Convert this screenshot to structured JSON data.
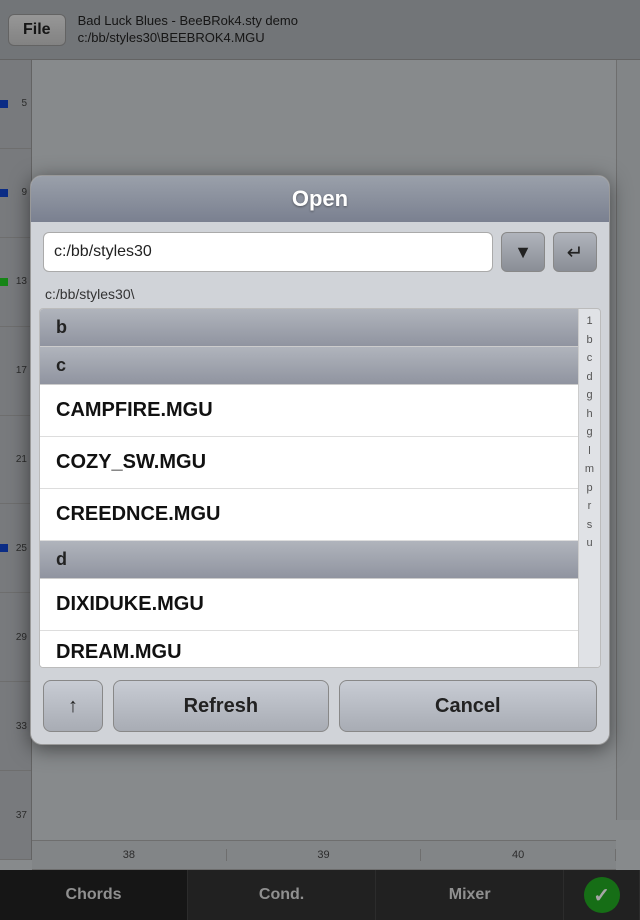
{
  "app": {
    "file_btn": "File",
    "top_title_line1": "Bad Luck Blues - BeeBRok4.sty demo",
    "top_title_line2": "c:/bb/styles30\\BEEBROK4.MGU"
  },
  "ruler": {
    "segments": [
      {
        "num": "5",
        "dot": "blue"
      },
      {
        "num": "9",
        "dot": "blue"
      },
      {
        "num": "13",
        "dot": "green"
      },
      {
        "num": "17",
        "dot": "none"
      },
      {
        "num": "21",
        "dot": "none"
      },
      {
        "num": "25",
        "dot": "blue"
      },
      {
        "num": "29",
        "dot": "none"
      },
      {
        "num": "33",
        "dot": "none"
      },
      {
        "num": "37",
        "dot": "none"
      }
    ]
  },
  "right_index_letters": [
    "1",
    "b",
    "c",
    "d",
    "g",
    "h",
    "g",
    "l",
    "m",
    "p",
    "r",
    "s",
    "u"
  ],
  "timeline_marks": [
    "38",
    "39",
    "40"
  ],
  "tab_bar": {
    "tabs": [
      {
        "label": "Chords",
        "active": true
      },
      {
        "label": "Cond.",
        "active": false
      },
      {
        "label": "Mixer",
        "active": false
      }
    ],
    "check_icon": "✓"
  },
  "modal": {
    "title": "Open",
    "path_value": "c:/bb/styles30",
    "path_placeholder": "c:/bb/styles30",
    "current_path": "c:/bb/styles30\\",
    "dropdown_icon": "▼",
    "enter_icon": "↵",
    "file_list": [
      {
        "type": "header",
        "label": "b"
      },
      {
        "type": "header",
        "label": "c"
      },
      {
        "type": "file",
        "name": "CAMPFIRE.MGU"
      },
      {
        "type": "file",
        "name": "COZY_SW.MGU"
      },
      {
        "type": "file",
        "name": "CREEDNCE.MGU"
      },
      {
        "type": "header",
        "label": "d"
      },
      {
        "type": "file",
        "name": "DIXIDUKE.MGU"
      },
      {
        "type": "file-partial",
        "name": "DREAM.MGU"
      }
    ],
    "index_letters": [
      "1",
      "b",
      "c",
      "d",
      "g",
      "h",
      "g",
      "l",
      "m",
      "p",
      "r",
      "s",
      "u"
    ],
    "buttons": {
      "up_icon": "↑",
      "refresh": "Refresh",
      "cancel": "Cancel"
    }
  }
}
